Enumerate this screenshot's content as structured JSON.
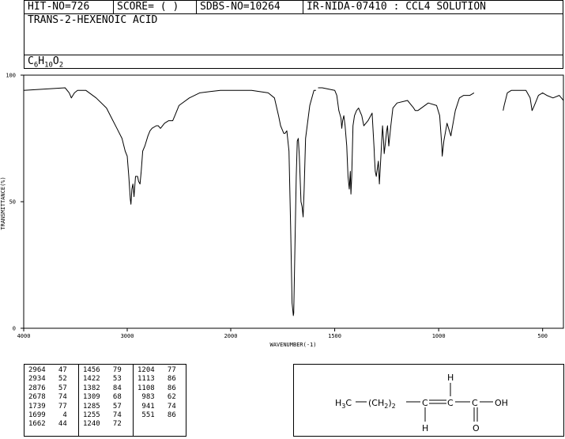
{
  "header": {
    "hit_no": "HIT-NO=726",
    "score": "SCORE=  (   )",
    "sdbs_no": "SDBS-NO=10264",
    "ir_id": "IR-NIDA-07410 : CCL4 SOLUTION",
    "compound_name": "TRANS-2-HEXENOIC ACID",
    "formula": {
      "c": "C",
      "c_n": "6",
      "h": "H",
      "h_n": "10",
      "o": "O",
      "o_n": "2"
    }
  },
  "chart_data": {
    "type": "line",
    "xlabel": "WAVENUMBER(-1)",
    "ylabel": "TRANSMITTANCE(%)",
    "xlim": [
      4000,
      400
    ],
    "ylim": [
      0,
      100
    ],
    "x_ticks": [
      4000,
      3000,
      2000,
      1500,
      1000,
      500
    ],
    "x_tick_labels": [
      "4000",
      "3000",
      "2000",
      "1500",
      "1000",
      "500"
    ],
    "y_ticks": [
      0,
      50,
      100
    ],
    "y_tick_labels": [
      "0",
      "50",
      "100"
    ],
    "grid": false,
    "legend": "none",
    "series": [
      {
        "x": [
          4000,
          3800,
          3600,
          3560,
          3540,
          3510,
          3480,
          3400,
          3300,
          3200,
          3150,
          3100,
          3050,
          3020,
          3000,
          2985,
          2970,
          2964,
          2955,
          2945,
          2934,
          2920,
          2900,
          2890,
          2876,
          2865,
          2850,
          2830,
          2800,
          2780,
          2760,
          2720,
          2700,
          2680,
          2678,
          2640,
          2600,
          2580,
          2560,
          2540,
          2500,
          2400,
          2300,
          2200,
          2100,
          2000,
          1900,
          1820,
          1790,
          1770,
          1760,
          1750,
          1745,
          1739,
          1730,
          1720,
          1712,
          1705,
          1700,
          1699,
          1697,
          1692,
          1685,
          1680,
          1675,
          1670,
          1662,
          1657,
          1652,
          1647,
          1640,
          1620,
          1600,
          1590
        ],
        "y": [
          94,
          94.5,
          95,
          93,
          91,
          93,
          94,
          94,
          91,
          87,
          83,
          79,
          75,
          70,
          68,
          60,
          51,
          49,
          55,
          57,
          52,
          60,
          60,
          58,
          57,
          62,
          70,
          72,
          76,
          78,
          79,
          80,
          80,
          79,
          79,
          81,
          82,
          82,
          82,
          84,
          88,
          91,
          93,
          93.5,
          94,
          94,
          94,
          93,
          91,
          84,
          80,
          78,
          77,
          77,
          78,
          70,
          40,
          10,
          6,
          5,
          6,
          28,
          60,
          74,
          75,
          68,
          50,
          48,
          44,
          55,
          75,
          88,
          94,
          94
        ]
      },
      {
        "x": [
          1580,
          1560,
          1500,
          1490,
          1480,
          1470,
          1466,
          1462,
          1456,
          1450,
          1442,
          1436,
          1430,
          1425,
          1422,
          1418,
          1412,
          1405,
          1395,
          1385,
          1380,
          1370,
          1360,
          1340,
          1320,
          1310,
          1309,
          1305,
          1300,
          1290,
          1285,
          1280,
          1270,
          1265,
          1262,
          1255,
          1250,
          1246,
          1240,
          1230,
          1220,
          1200,
          1150,
          1120,
          1113,
          1110,
          1108,
          1100,
          1050,
          1010,
          995,
          985,
          983,
          975,
          960,
          941,
          935,
          920,
          900,
          880,
          850,
          830
        ],
        "y": [
          95,
          95,
          94,
          92,
          86,
          83,
          79,
          82,
          84,
          80,
          72,
          60,
          55,
          62,
          53,
          60,
          80,
          84,
          86,
          87,
          86,
          84,
          80,
          82,
          85,
          70,
          68,
          62,
          60,
          66,
          57,
          65,
          80,
          74,
          69,
          74,
          78,
          80,
          72,
          80,
          87,
          89,
          90,
          87,
          86,
          86,
          86,
          86,
          89,
          88,
          84,
          72,
          68,
          74,
          81,
          76,
          79,
          86,
          91,
          92,
          92,
          93
        ]
      },
      {
        "x": [
          690,
          685,
          670,
          650,
          620,
          580,
          560,
          551,
          540,
          520,
          500,
          480,
          450,
          420,
          410,
          400
        ],
        "y": [
          86,
          88,
          93,
          94,
          94,
          94,
          91,
          86,
          88,
          92,
          93,
          92,
          91,
          92,
          91,
          90
        ]
      }
    ],
    "peak_table_columns": [
      [
        [
          "2964",
          "47"
        ],
        [
          "2934",
          "52"
        ],
        [
          "2876",
          "57"
        ],
        [
          "2678",
          "74"
        ],
        [
          "1739",
          "77"
        ],
        [
          "1699",
          "4"
        ],
        [
          "1662",
          "44"
        ]
      ],
      [
        [
          "1456",
          "79"
        ],
        [
          "1422",
          "53"
        ],
        [
          "1382",
          "84"
        ],
        [
          "1309",
          "68"
        ],
        [
          "1285",
          "57"
        ],
        [
          "1255",
          "74"
        ],
        [
          "1240",
          "72"
        ]
      ],
      [
        [
          "1204",
          "77"
        ],
        [
          "1113",
          "86"
        ],
        [
          "1108",
          "86"
        ],
        [
          "983",
          "62"
        ],
        [
          "941",
          "74"
        ],
        [
          "551",
          "86"
        ]
      ]
    ]
  },
  "structure": {
    "h3c": "H",
    "h3c_sub": "3",
    "h3c_tail": "C",
    "chain": "(CH",
    "chain_sub": "2",
    "chain_tail": ")",
    "chain_n": "2",
    "h_top": "H",
    "h_bottom": "H",
    "o_label": "O",
    "oh_label": "OH"
  }
}
